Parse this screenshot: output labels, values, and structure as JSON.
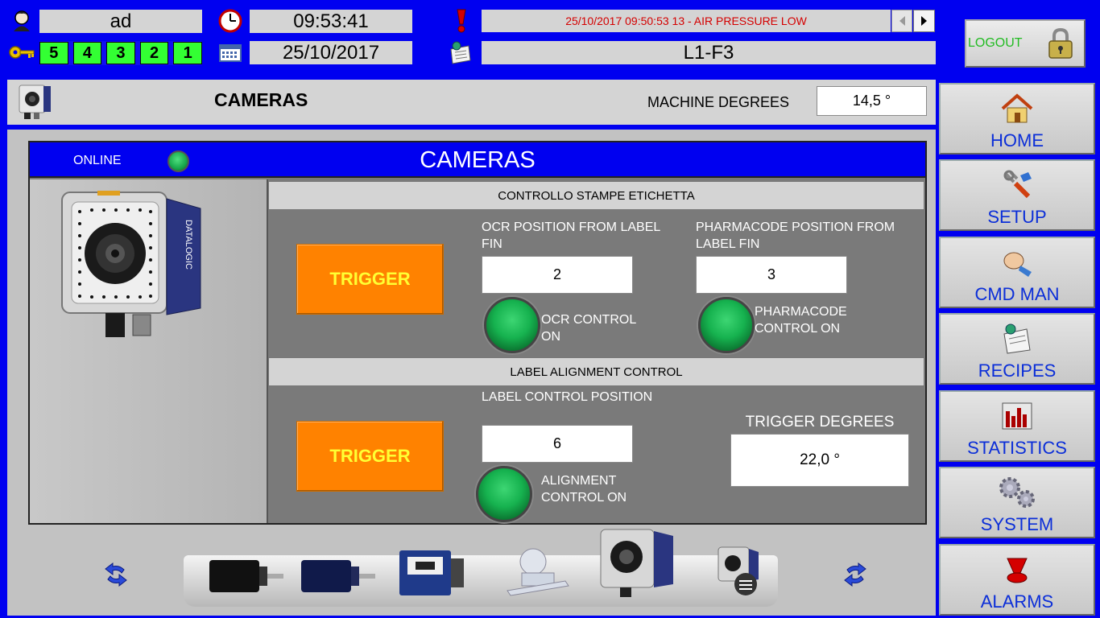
{
  "header": {
    "user": "ad",
    "time": "09:53:41",
    "date": "25/10/2017",
    "alarm_message": "25/10/2017 09:50:53 13 - AIR PRESSURE LOW",
    "line": "L1-F3",
    "levels": [
      "5",
      "4",
      "3",
      "2",
      "1"
    ],
    "logout_label": "LOGOUT"
  },
  "title_bar": {
    "title": "CAMERAS",
    "machine_degrees_label": "MACHINE DEGREES",
    "machine_degrees_value": "14,5 °"
  },
  "panel": {
    "title": "CAMERAS",
    "online_label": "ONLINE",
    "section1": {
      "heading": "CONTROLLO STAMPE ETICHETTA",
      "trigger_label": "TRIGGER",
      "ocr_label": "OCR POSITION FROM LABEL FIN",
      "ocr_value": "2",
      "pharma_label": "PHARMACODE POSITION FROM LABEL FIN",
      "pharma_value": "3",
      "ocr_control_label": "OCR CONTROL ON",
      "pharma_control_label": "PHARMACODE CONTROL ON"
    },
    "section2": {
      "heading": "LABEL ALIGNMENT CONTROL",
      "trigger_label": "TRIGGER",
      "position_label": "LABEL CONTROL POSITION",
      "position_value": "6",
      "alignment_label": "ALIGNMENT CONTROL ON",
      "trigger_degrees_label": "TRIGGER DEGREES",
      "trigger_degrees_value": "22,0 °"
    }
  },
  "nav": {
    "items": [
      {
        "label": "HOME",
        "icon": "home-icon"
      },
      {
        "label": "SETUP",
        "icon": "tools-icon"
      },
      {
        "label": "CMD MAN",
        "icon": "hand-icon"
      },
      {
        "label": "RECIPES",
        "icon": "recipe-icon"
      },
      {
        "label": "STATISTICS",
        "icon": "chart-icon"
      },
      {
        "label": "SYSTEM",
        "icon": "gears-icon"
      },
      {
        "label": "ALARMS",
        "icon": "alarm-light-icon"
      }
    ]
  },
  "colors": {
    "frame": "#0000f0",
    "panel_gray": "#7a7a7a",
    "trigger_orange": "#ff8200",
    "trigger_text": "#ffff33",
    "level_green": "#33ff33",
    "nav_text": "#0b2ed8",
    "alarm_text": "#d40000"
  }
}
